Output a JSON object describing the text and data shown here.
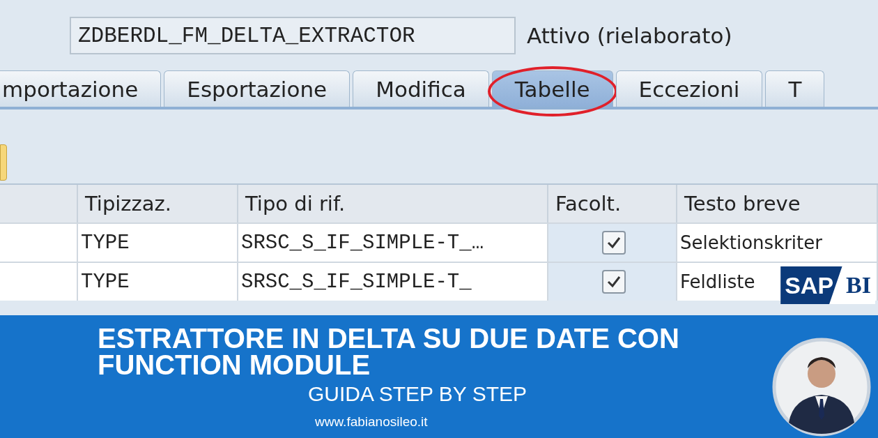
{
  "header": {
    "function_name": "ZDBERDL_FM_DELTA_EXTRACTOR",
    "status": "Attivo (rielaborato)"
  },
  "tabs": [
    {
      "label": "mportazione",
      "selected": false
    },
    {
      "label": "Esportazione",
      "selected": false
    },
    {
      "label": "Modifica",
      "selected": false
    },
    {
      "label": "Tabelle",
      "selected": true,
      "circled": true
    },
    {
      "label": "Eccezioni",
      "selected": false
    },
    {
      "label": "T",
      "selected": false
    }
  ],
  "table": {
    "columns": [
      "",
      "Tipizzaz.",
      "Tipo di rif.",
      "Facolt.",
      "Testo breve"
    ],
    "rows": [
      {
        "typing": "TYPE",
        "ref_type": "SRSC_S_IF_SIMPLE-T_…",
        "optional": true,
        "short_text": "Selektionskriter"
      },
      {
        "typing": "TYPE",
        "ref_type": "SRSC_S_IF_SIMPLE-T_",
        "optional": true,
        "short_text": "Feldliste"
      }
    ]
  },
  "logo": {
    "left": "SAP",
    "right": "BI"
  },
  "banner": {
    "title": "ESTRATTORE IN DELTA SU DUE DATE CON FUNCTION MODULE",
    "subtitle": "GUIDA STEP BY STEP",
    "url": "www.fabianosileo.it"
  }
}
